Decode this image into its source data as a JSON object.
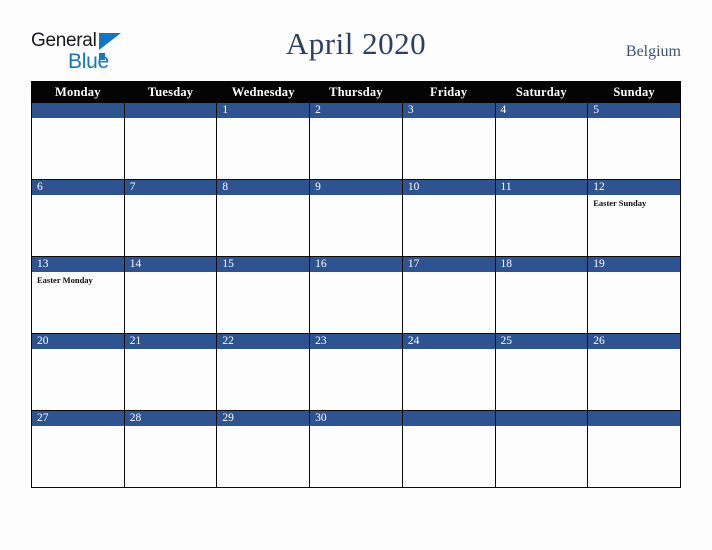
{
  "brand": {
    "name_part1": "General",
    "name_part2": "Blue",
    "triangle_icon": "brand-triangle-icon",
    "color_dark": "#19191d",
    "color_blue": "#1277c4"
  },
  "header": {
    "title": "April 2020",
    "country": "Belgium",
    "title_color": "#2c3f63",
    "country_color": "#3d5277"
  },
  "calendar": {
    "month": "April",
    "year": "2020",
    "header_bg": "#030303",
    "daybar_bg": "#2d5391",
    "cell_bg": "#fdfdfd",
    "weekday_headers": [
      "Monday",
      "Tuesday",
      "Wednesday",
      "Thursday",
      "Friday",
      "Saturday",
      "Sunday"
    ],
    "weeks": [
      [
        {
          "date": "",
          "event": ""
        },
        {
          "date": "",
          "event": ""
        },
        {
          "date": "1",
          "event": ""
        },
        {
          "date": "2",
          "event": ""
        },
        {
          "date": "3",
          "event": ""
        },
        {
          "date": "4",
          "event": ""
        },
        {
          "date": "5",
          "event": ""
        }
      ],
      [
        {
          "date": "6",
          "event": ""
        },
        {
          "date": "7",
          "event": ""
        },
        {
          "date": "8",
          "event": ""
        },
        {
          "date": "9",
          "event": ""
        },
        {
          "date": "10",
          "event": ""
        },
        {
          "date": "11",
          "event": ""
        },
        {
          "date": "12",
          "event": "Easter Sunday"
        }
      ],
      [
        {
          "date": "13",
          "event": "Easter Monday"
        },
        {
          "date": "14",
          "event": ""
        },
        {
          "date": "15",
          "event": ""
        },
        {
          "date": "16",
          "event": ""
        },
        {
          "date": "17",
          "event": ""
        },
        {
          "date": "18",
          "event": ""
        },
        {
          "date": "19",
          "event": ""
        }
      ],
      [
        {
          "date": "20",
          "event": ""
        },
        {
          "date": "21",
          "event": ""
        },
        {
          "date": "22",
          "event": ""
        },
        {
          "date": "23",
          "event": ""
        },
        {
          "date": "24",
          "event": ""
        },
        {
          "date": "25",
          "event": ""
        },
        {
          "date": "26",
          "event": ""
        }
      ],
      [
        {
          "date": "27",
          "event": ""
        },
        {
          "date": "28",
          "event": ""
        },
        {
          "date": "29",
          "event": ""
        },
        {
          "date": "30",
          "event": ""
        },
        {
          "date": "",
          "event": ""
        },
        {
          "date": "",
          "event": ""
        },
        {
          "date": "",
          "event": ""
        }
      ]
    ]
  }
}
